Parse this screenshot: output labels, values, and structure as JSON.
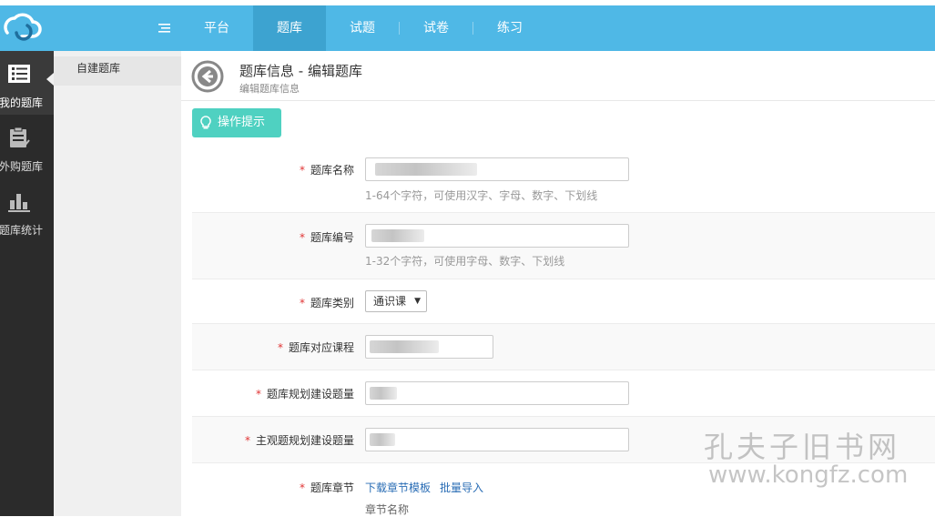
{
  "nav": {
    "items": [
      {
        "label": "平台",
        "active": false
      },
      {
        "label": "题库",
        "active": true
      },
      {
        "label": "试题",
        "active": false
      },
      {
        "label": "试卷",
        "active": false
      },
      {
        "label": "练习",
        "active": false
      }
    ]
  },
  "rail": {
    "items": [
      {
        "label": "我的题库",
        "icon": "list-icon",
        "active": true
      },
      {
        "label": "外购题库",
        "icon": "clipboard-icon",
        "active": false
      },
      {
        "label": "题库统计",
        "icon": "bar-chart-icon",
        "active": false
      }
    ]
  },
  "subside": {
    "items": [
      {
        "label": "自建题库"
      }
    ]
  },
  "header": {
    "title": "题库信息 - 编辑题库",
    "subtitle": "编辑题库信息"
  },
  "tip_button": {
    "label": "操作提示",
    "icon": "lightbulb-icon"
  },
  "form": {
    "name": {
      "label": "题库名称",
      "hint": "1-64个字符，可使用汉字、字母、数字、下划线"
    },
    "code": {
      "label": "题库编号",
      "hint": "1-32个字符，可使用字母、数字、下划线"
    },
    "category": {
      "label": "题库类别",
      "value": "通识课"
    },
    "course": {
      "label": "题库对应课程"
    },
    "planned": {
      "label": "题库规划建设题量"
    },
    "subjective": {
      "label": "主观题规划建设题量"
    },
    "chapters": {
      "label": "题库章节",
      "download_link": "下载章节模板",
      "import_link": "批量导入",
      "chapter_name": "章节名称"
    }
  },
  "watermark": {
    "line1": "孔夫子旧书网",
    "line2": "www.kongfz.com"
  },
  "colors": {
    "topbar": "#4fb8e6",
    "active_nav": "#3da3d0",
    "rail": "#2b2b2b",
    "tip_button": "#4fd1c1",
    "required": "#e03434",
    "link": "#2a6db5"
  }
}
